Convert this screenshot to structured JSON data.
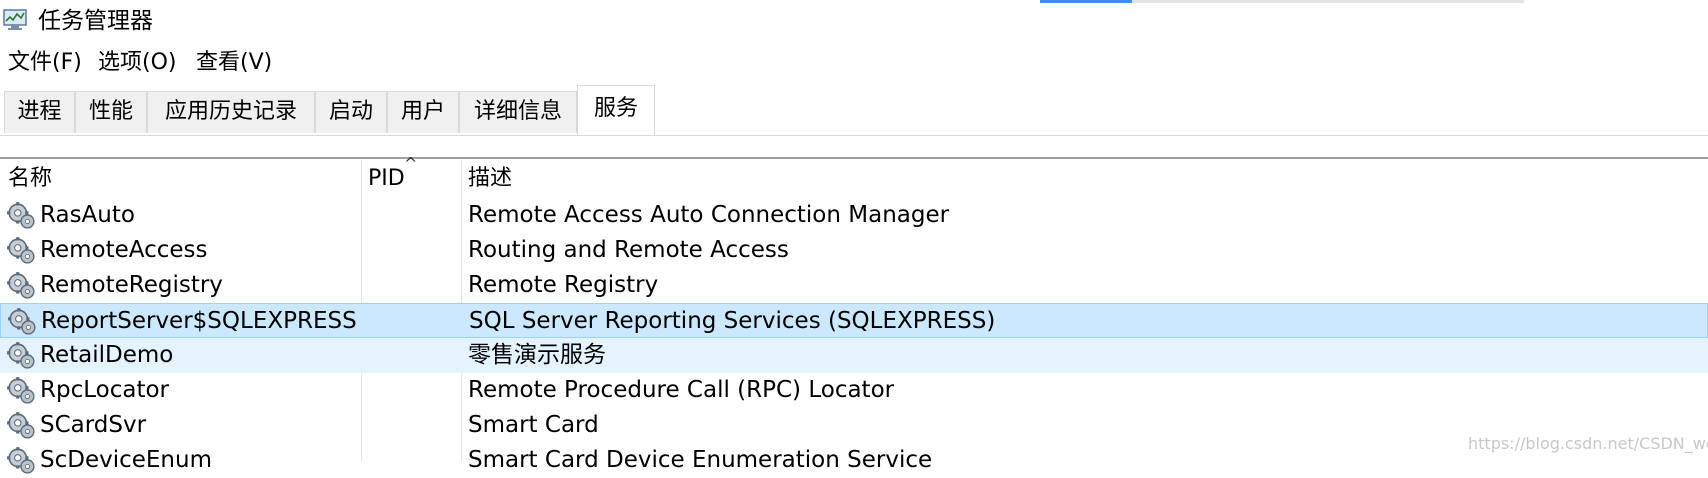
{
  "window": {
    "title": "任务管理器"
  },
  "menu": {
    "items": [
      "文件(F)",
      "选项(O)",
      "查看(V)"
    ]
  },
  "tabs": [
    "进程",
    "性能",
    "应用历史记录",
    "启动",
    "用户",
    "详细信息",
    "服务"
  ],
  "active_tab": "服务",
  "columns": {
    "name": "名称",
    "pid": "PID",
    "desc": "描述"
  },
  "sort": {
    "column": "PID",
    "direction": "ascending"
  },
  "services": [
    {
      "name": "RasAuto",
      "pid": "",
      "desc": "Remote Access Auto Connection Manager",
      "state": "normal"
    },
    {
      "name": "RemoteAccess",
      "pid": "",
      "desc": "Routing and Remote Access",
      "state": "normal"
    },
    {
      "name": "RemoteRegistry",
      "pid": "",
      "desc": "Remote Registry",
      "state": "normal"
    },
    {
      "name": "ReportServer$SQLEXPRESS",
      "pid": "",
      "desc": "SQL Server Reporting Services (SQLEXPRESS)",
      "state": "selected"
    },
    {
      "name": "RetailDemo",
      "pid": "",
      "desc": "零售演示服务",
      "state": "hover"
    },
    {
      "name": "RpcLocator",
      "pid": "",
      "desc": "Remote Procedure Call (RPC) Locator",
      "state": "normal"
    },
    {
      "name": "SCardSvr",
      "pid": "",
      "desc": "Smart Card",
      "state": "normal"
    },
    {
      "name": "ScDeviceEnum",
      "pid": "",
      "desc": "Smart Card Device Enumeration Service",
      "state": "normal"
    }
  ],
  "watermark": "https://blog.csdn.net/CSDN_wcy",
  "icons": {
    "app": "task-manager-icon",
    "service": "service-gear-icon",
    "sort": "sort-caret-icon"
  },
  "colors": {
    "selected_bg": "#cce8ff",
    "selected_border": "#99d1ff",
    "hover_bg": "#e5f3ff",
    "accent": "#3c8ee8"
  }
}
